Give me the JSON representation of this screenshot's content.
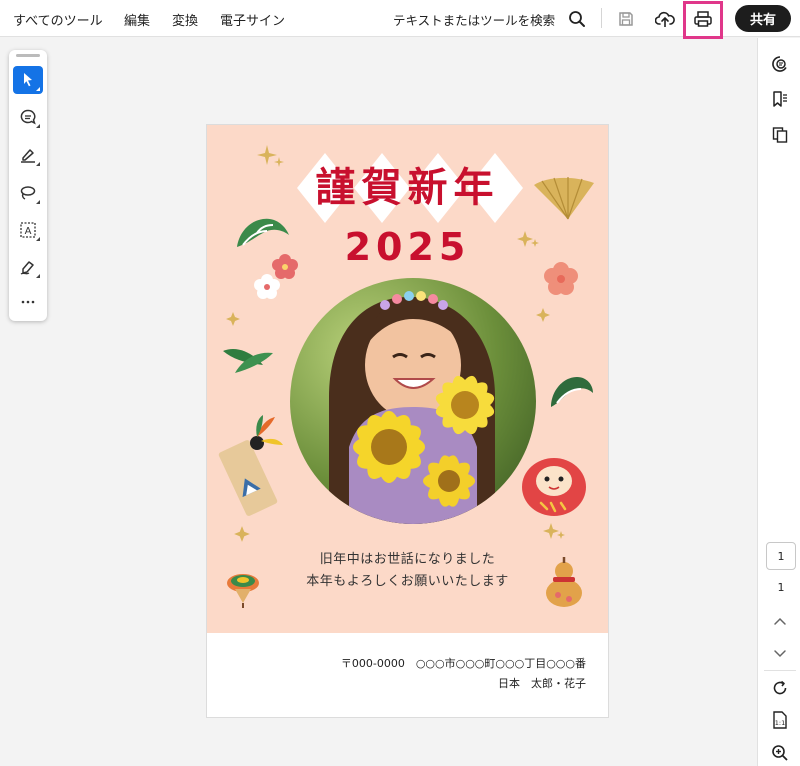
{
  "menu": {
    "all_tools": "すべてのツール",
    "edit": "編集",
    "convert": "変換",
    "e_sign": "電子サイン"
  },
  "search": {
    "label": "テキストまたはツールを検索"
  },
  "share_label": "共有",
  "toolbar_icons": [
    "search-icon",
    "save-icon",
    "upload-cloud-icon",
    "print-icon"
  ],
  "tool_palette": [
    "select-cursor-icon",
    "comment-icon",
    "highlight-pen-icon",
    "lasso-icon",
    "text-select-icon",
    "sign-pen-icon",
    "more-icon"
  ],
  "right_rail": {
    "icons": [
      "ai-assistant-icon",
      "bookmark-list-icon",
      "copy-pages-icon",
      "chevron-up-icon",
      "chevron-down-icon",
      "rotate-icon",
      "fit-page-icon",
      "zoom-in-icon"
    ],
    "current_page": "1",
    "total_pages": "1"
  },
  "card": {
    "title": "謹賀新年",
    "year": "2025",
    "greeting_line1": "旧年中はお世話になりました",
    "greeting_line2": "本年もよろしくお願いいたします",
    "address_line1": "〒000-0000　○○○市○○○町○○○丁目○○○番",
    "address_line2": "日本　太郎・花子"
  },
  "colors": {
    "accent_blue": "#1473e6",
    "highlight_pink": "#e0378a",
    "card_background": "#fcd9c8",
    "title_red": "#c8102e",
    "share_button": "#1d1d1d"
  }
}
